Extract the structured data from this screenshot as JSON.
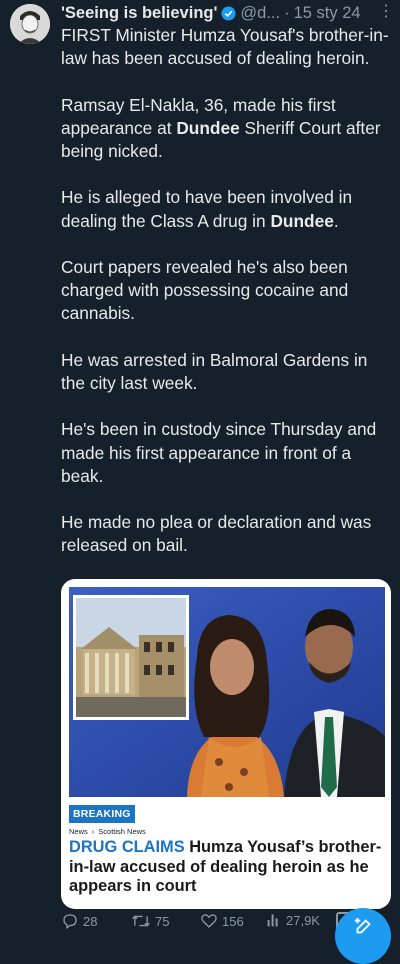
{
  "author": {
    "display_name": "'Seeing is believing'",
    "handle": "@d...",
    "separator": "·",
    "time": "15 sty 24",
    "more_icon": "⋮"
  },
  "tweet": {
    "paragraphs": [
      {
        "parts": [
          "FIRST Minister Humza Yousaf's brother-in- law has been accused of dealing heroin."
        ]
      },
      {
        "parts": [
          "Ramsay El-Nakla, 36, made his first appearance at ",
          "Dundee",
          " Sheriff Court after being nicked."
        ]
      },
      {
        "parts": [
          "He is alleged to have been involved in dealing the Class A drug in ",
          "Dundee",
          "."
        ]
      },
      {
        "parts": [
          "Court papers revealed he's also been charged with possessing cocaine and cannabis."
        ]
      },
      {
        "parts": [
          "He was arrested in Balmoral Gardens in the city last week."
        ]
      },
      {
        "parts": [
          "He's been in custody since Thursday and made his first appearance in front of a beak."
        ]
      },
      {
        "parts": [
          "He made no plea or declaration and was released on bail."
        ]
      }
    ]
  },
  "card": {
    "badge": "BREAKING",
    "breadcrumb_1": "News",
    "breadcrumb_sep": "›",
    "breadcrumb_2": "Scottish News",
    "headline_accent": "DRUG CLAIMS",
    "headline_rest": " Humza Yousaf’s brother-in-law accused of dealing heroin as he appears in court",
    "accent_color": "#1b75c4"
  },
  "actions": {
    "replies": "28",
    "reposts": "75",
    "likes": "156",
    "views": "27,9K"
  },
  "compose_icon": "compose-plus-icon",
  "colors": {
    "background": "#15202b",
    "text": "#e7e9ea",
    "muted": "#8b98a5",
    "accent_blue": "#1d9bf0"
  }
}
